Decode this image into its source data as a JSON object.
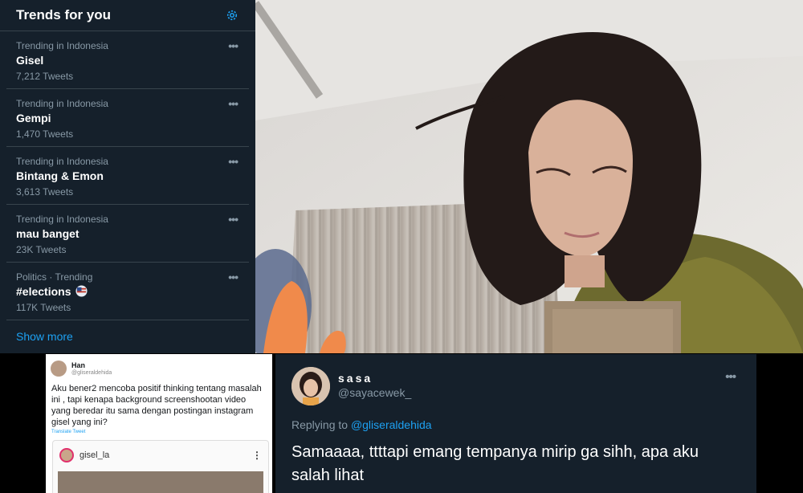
{
  "trends": {
    "title": "Trends for you",
    "settings_icon": "gear-icon",
    "accent": "#1da1f2",
    "items": [
      {
        "context": "Trending in Indonesia",
        "name": "Gisel",
        "count": "7,212 Tweets"
      },
      {
        "context": "Trending in Indonesia",
        "name": "Gempi",
        "count": "1,470 Tweets"
      },
      {
        "context": "Trending in Indonesia",
        "name": "Bintang & Emon",
        "count": "3,613 Tweets"
      },
      {
        "context": "Trending in Indonesia",
        "name": "mau banget",
        "count": "23K Tweets"
      },
      {
        "context": "Politics · Trending",
        "name": "#elections",
        "count": "117K Tweets"
      }
    ],
    "more_glyph": "•••",
    "show_more": "Show more"
  },
  "tweet_card": {
    "name": "Han",
    "handle": "@gliseraldehida",
    "body": "Aku bener2 mencoba positif thinking tentang masalah ini , tapi kenapa background screenshootan video yang beredar itu sama dengan postingan instagram gisel yang ini?",
    "source": "Translate Tweet",
    "instagram": {
      "user": "gisel_la",
      "menu": "⋮"
    }
  },
  "reply_tweet": {
    "name": "sasa",
    "handle": "@sayacewek_",
    "more_glyph": "•••",
    "replying_prefix": "Replying to",
    "replying_handle": "@gliseraldehida",
    "text": "Samaaaa, ttttapi emang tempanya mirip ga sihh, apa aku salah lihat"
  }
}
